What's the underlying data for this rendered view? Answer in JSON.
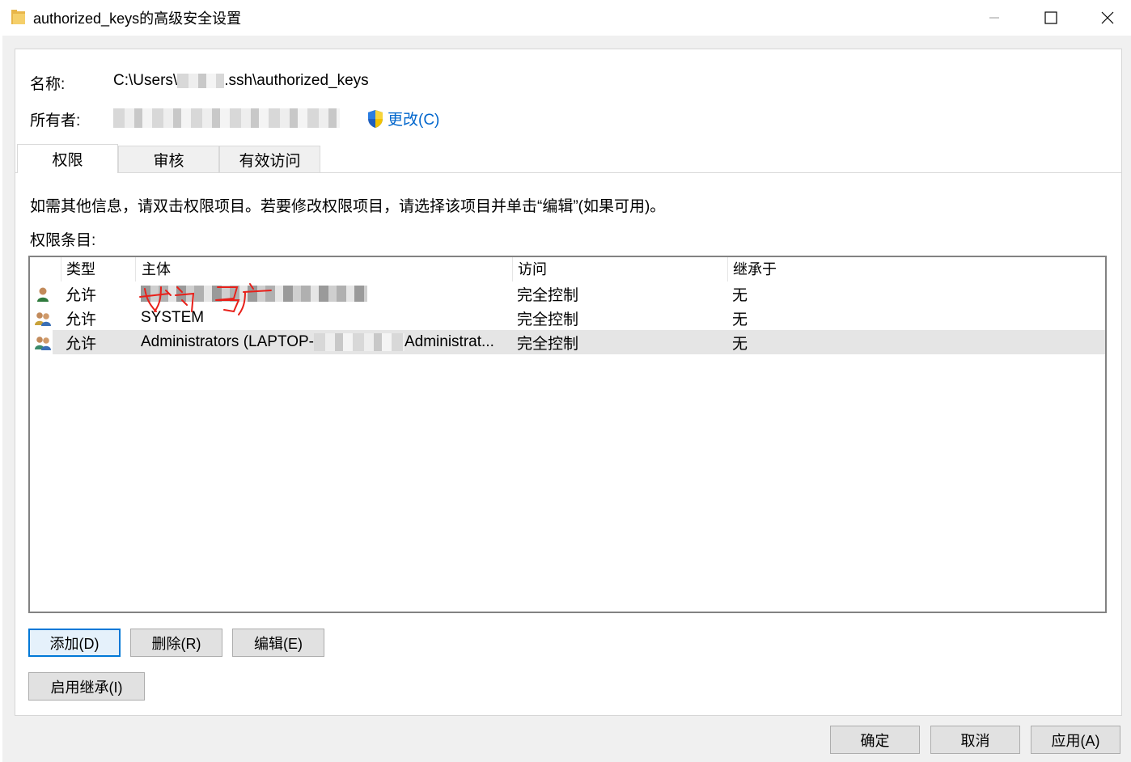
{
  "window": {
    "title": "authorized_keys的高级安全设置"
  },
  "details": {
    "name_label": "名称:",
    "name_prefix": "C:\\Users\\",
    "name_suffix": ".ssh\\authorized_keys",
    "owner_label": "所有者:",
    "change_link": "更改(C)"
  },
  "tabs": [
    {
      "label": "权限",
      "active": true
    },
    {
      "label": "审核",
      "active": false
    },
    {
      "label": "有效访问",
      "active": false
    }
  ],
  "info_text": "如需其他信息，请双击权限项目。若要修改权限项目，请选择该项目并单击“编辑”(如果可用)。",
  "entries_label": "权限条目:",
  "table": {
    "headers": [
      "类型",
      "主体",
      "访问",
      "继承于"
    ],
    "rows": [
      {
        "icon": "user-icon",
        "type": "允许",
        "principal": "",
        "access": "完全控制",
        "inherited": "无",
        "selected": false
      },
      {
        "icon": "group-icon",
        "type": "允许",
        "principal": "SYSTEM",
        "access": "完全控制",
        "inherited": "无",
        "selected": false
      },
      {
        "icon": "group-icon",
        "type": "允许",
        "principal_prefix": "Administrators (LAPTOP-",
        "principal_suffix": "Administrat...",
        "access": "完全控制",
        "inherited": "无",
        "selected": true
      }
    ]
  },
  "buttons": {
    "add": "添加(D)",
    "remove": "删除(R)",
    "edit": "编辑(E)",
    "enable_inheritance": "启用继承(I)",
    "ok": "确定",
    "cancel": "取消",
    "apply": "应用(A)"
  },
  "colors": {
    "link": "#0066cc",
    "selection": "#e5e5e5",
    "default_button_border": "#0078d7"
  }
}
